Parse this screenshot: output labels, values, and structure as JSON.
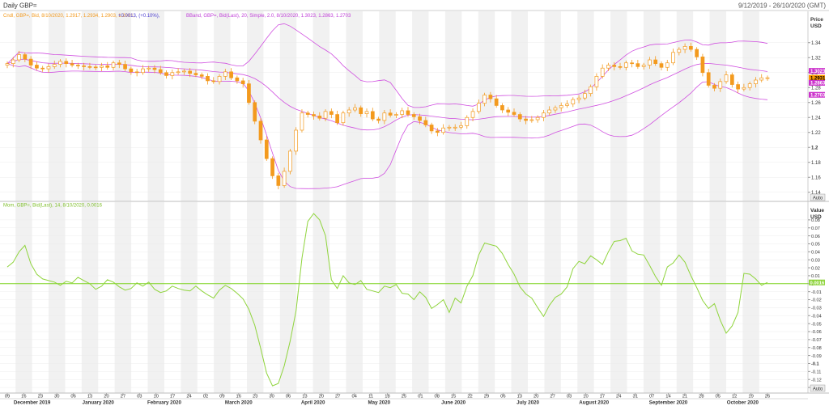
{
  "window": {
    "title": "Daily GBP=",
    "date_range": "9/12/2019 - 26/10/2020 (GMT)"
  },
  "buttons": {
    "auto_top": "Auto",
    "auto_bottom": "Auto"
  },
  "colors": {
    "candle": "#f39a1e",
    "bband": "#d050e0",
    "momentum": "#8fd43c",
    "zero_line": "#7ed321",
    "grid": "#f1f1f1",
    "axis_text": "#333333",
    "price_badge_bg": "#ff9a00",
    "band_badge_bg": "#cc33cc"
  },
  "chart_data": [
    {
      "type": "candlestick",
      "legend": {
        "candle": "Cndl, GBP=, Bid, 8/10/2020, 1.2917, 1.2934, 1.2903, 1.2931, ",
        "change": "+0.0013, (+0.10%),",
        "bband": "BBand, GBP=, Bid(Last), 20, Simple, 2.0, 8/10/2020, 1.3023, 1.2863, 1.2703"
      },
      "ylabel": "Price",
      "yunit": "USD",
      "ylim": [
        1.13,
        1.37
      ],
      "yticks": [
        "1.34",
        "1.32",
        "1.3",
        "1.28",
        "1.26",
        "1.24",
        "1.22",
        "1.2",
        "1.18",
        "1.16",
        "1.14"
      ],
      "last_values": {
        "upper_band": "1.3023",
        "close": "1.2931",
        "middle_band": "1.2863",
        "lower_band": "1.2703"
      },
      "close": [
        1.312,
        1.317,
        1.324,
        1.318,
        1.31,
        1.306,
        1.305,
        1.308,
        1.311,
        1.315,
        1.312,
        1.31,
        1.309,
        1.308,
        1.3075,
        1.307,
        1.309,
        1.307,
        1.313,
        1.311,
        1.305,
        1.301,
        1.3,
        1.305,
        1.306,
        1.304,
        1.3,
        1.296,
        1.3,
        1.301,
        1.302,
        1.299,
        1.297,
        1.295,
        1.289,
        1.288,
        1.295,
        1.301,
        1.293,
        1.289,
        1.285,
        1.26,
        1.235,
        1.21,
        1.185,
        1.162,
        1.149,
        1.168,
        1.195,
        1.223,
        1.246,
        1.244,
        1.242,
        1.239,
        1.248,
        1.244,
        1.233,
        1.246,
        1.25,
        1.253,
        1.245,
        1.248,
        1.238,
        1.236,
        1.246,
        1.243,
        1.244,
        1.249,
        1.244,
        1.241,
        1.236,
        1.23,
        1.222,
        1.22,
        1.226,
        1.227,
        1.227,
        1.229,
        1.24,
        1.248,
        1.259,
        1.27,
        1.265,
        1.256,
        1.25,
        1.247,
        1.244,
        1.238,
        1.236,
        1.237,
        1.24,
        1.246,
        1.25,
        1.253,
        1.256,
        1.258,
        1.264,
        1.266,
        1.272,
        1.281,
        1.295,
        1.306,
        1.31,
        1.308,
        1.307,
        1.313,
        1.312,
        1.308,
        1.31,
        1.317,
        1.312,
        1.307,
        1.313,
        1.327,
        1.331,
        1.335,
        1.331,
        1.321,
        1.3,
        1.283,
        1.279,
        1.288,
        1.297,
        1.284,
        1.278,
        1.28,
        1.285,
        1.29,
        1.293,
        1.2931
      ]
    },
    {
      "type": "line",
      "legend": "Mom, GBP=, Bid(Last), 14, 8/10/2020, 0.0016",
      "ylabel": "Value",
      "yunit": "USD",
      "ylim": [
        -0.135,
        0.09
      ],
      "yticks": [
        "0.08",
        "0.07",
        "0.06",
        "0.05",
        "0.04",
        "0.03",
        "0.02",
        "0.01",
        "0",
        "-0.01",
        "-0.02",
        "-0.03",
        "-0.04",
        "-0.05",
        "-0.06",
        "-0.07",
        "-0.08",
        "-0.09",
        "-0.1",
        "-0.11",
        "-0.12",
        "-0.13"
      ],
      "last_value": "0.0016",
      "values": [
        0.021,
        0.027,
        0.04,
        0.048,
        0.025,
        0.012,
        0.006,
        0.004,
        0.002,
        -0.002,
        0.003,
        0.001,
        0.008,
        0.004,
        0.0,
        -0.007,
        -0.003,
        0.005,
        0.002,
        -0.004,
        -0.008,
        -0.006,
        0.001,
        -0.003,
        0.002,
        -0.007,
        -0.011,
        -0.009,
        -0.003,
        -0.006,
        -0.008,
        -0.009,
        -0.003,
        -0.009,
        -0.014,
        -0.018,
        -0.008,
        -0.002,
        -0.006,
        -0.012,
        -0.019,
        -0.032,
        -0.052,
        -0.081,
        -0.112,
        -0.128,
        -0.125,
        -0.103,
        -0.072,
        -0.034,
        0.032,
        0.078,
        0.088,
        0.08,
        0.06,
        0.005,
        -0.006,
        0.01,
        0.001,
        -0.001,
        0.004,
        -0.007,
        -0.009,
        -0.011,
        -0.003,
        -0.005,
        -0.001,
        -0.012,
        -0.013,
        -0.02,
        -0.01,
        -0.017,
        -0.031,
        -0.026,
        -0.02,
        -0.036,
        -0.018,
        -0.024,
        -0.003,
        0.01,
        0.036,
        0.051,
        0.049,
        0.047,
        0.038,
        0.024,
        0.012,
        -0.004,
        -0.013,
        -0.018,
        -0.03,
        -0.041,
        -0.027,
        -0.017,
        -0.013,
        -0.004,
        0.019,
        0.028,
        0.025,
        0.035,
        0.03,
        0.024,
        0.04,
        0.053,
        0.054,
        0.057,
        0.041,
        0.037,
        0.036,
        0.023,
        0.009,
        -0.002,
        0.021,
        0.026,
        0.036,
        0.027,
        0.01,
        -0.005,
        -0.021,
        -0.031,
        -0.025,
        -0.046,
        -0.062,
        -0.053,
        -0.036,
        0.013,
        0.012,
        0.006,
        -0.002,
        0.0016
      ]
    }
  ],
  "x_axis": {
    "day_labels": [
      "09",
      "16",
      "23",
      "30",
      "06",
      "13",
      "20",
      "27",
      "03",
      "10",
      "17",
      "24",
      "02",
      "09",
      "16",
      "23",
      "30",
      "06",
      "13",
      "20",
      "27",
      "04",
      "11",
      "18",
      "25",
      "01",
      "08",
      "15",
      "22",
      "29",
      "06",
      "13",
      "20",
      "27",
      "03",
      "10",
      "17",
      "24",
      "31",
      "07",
      "14",
      "21",
      "28",
      "05",
      "12",
      "19",
      "26"
    ],
    "month_labels": [
      "December 2019",
      "January 2020",
      "February 2020",
      "March 2020",
      "April 2020",
      "May 2020",
      "June 2020",
      "July 2020",
      "August 2020",
      "September 2020",
      "October 2020"
    ]
  }
}
